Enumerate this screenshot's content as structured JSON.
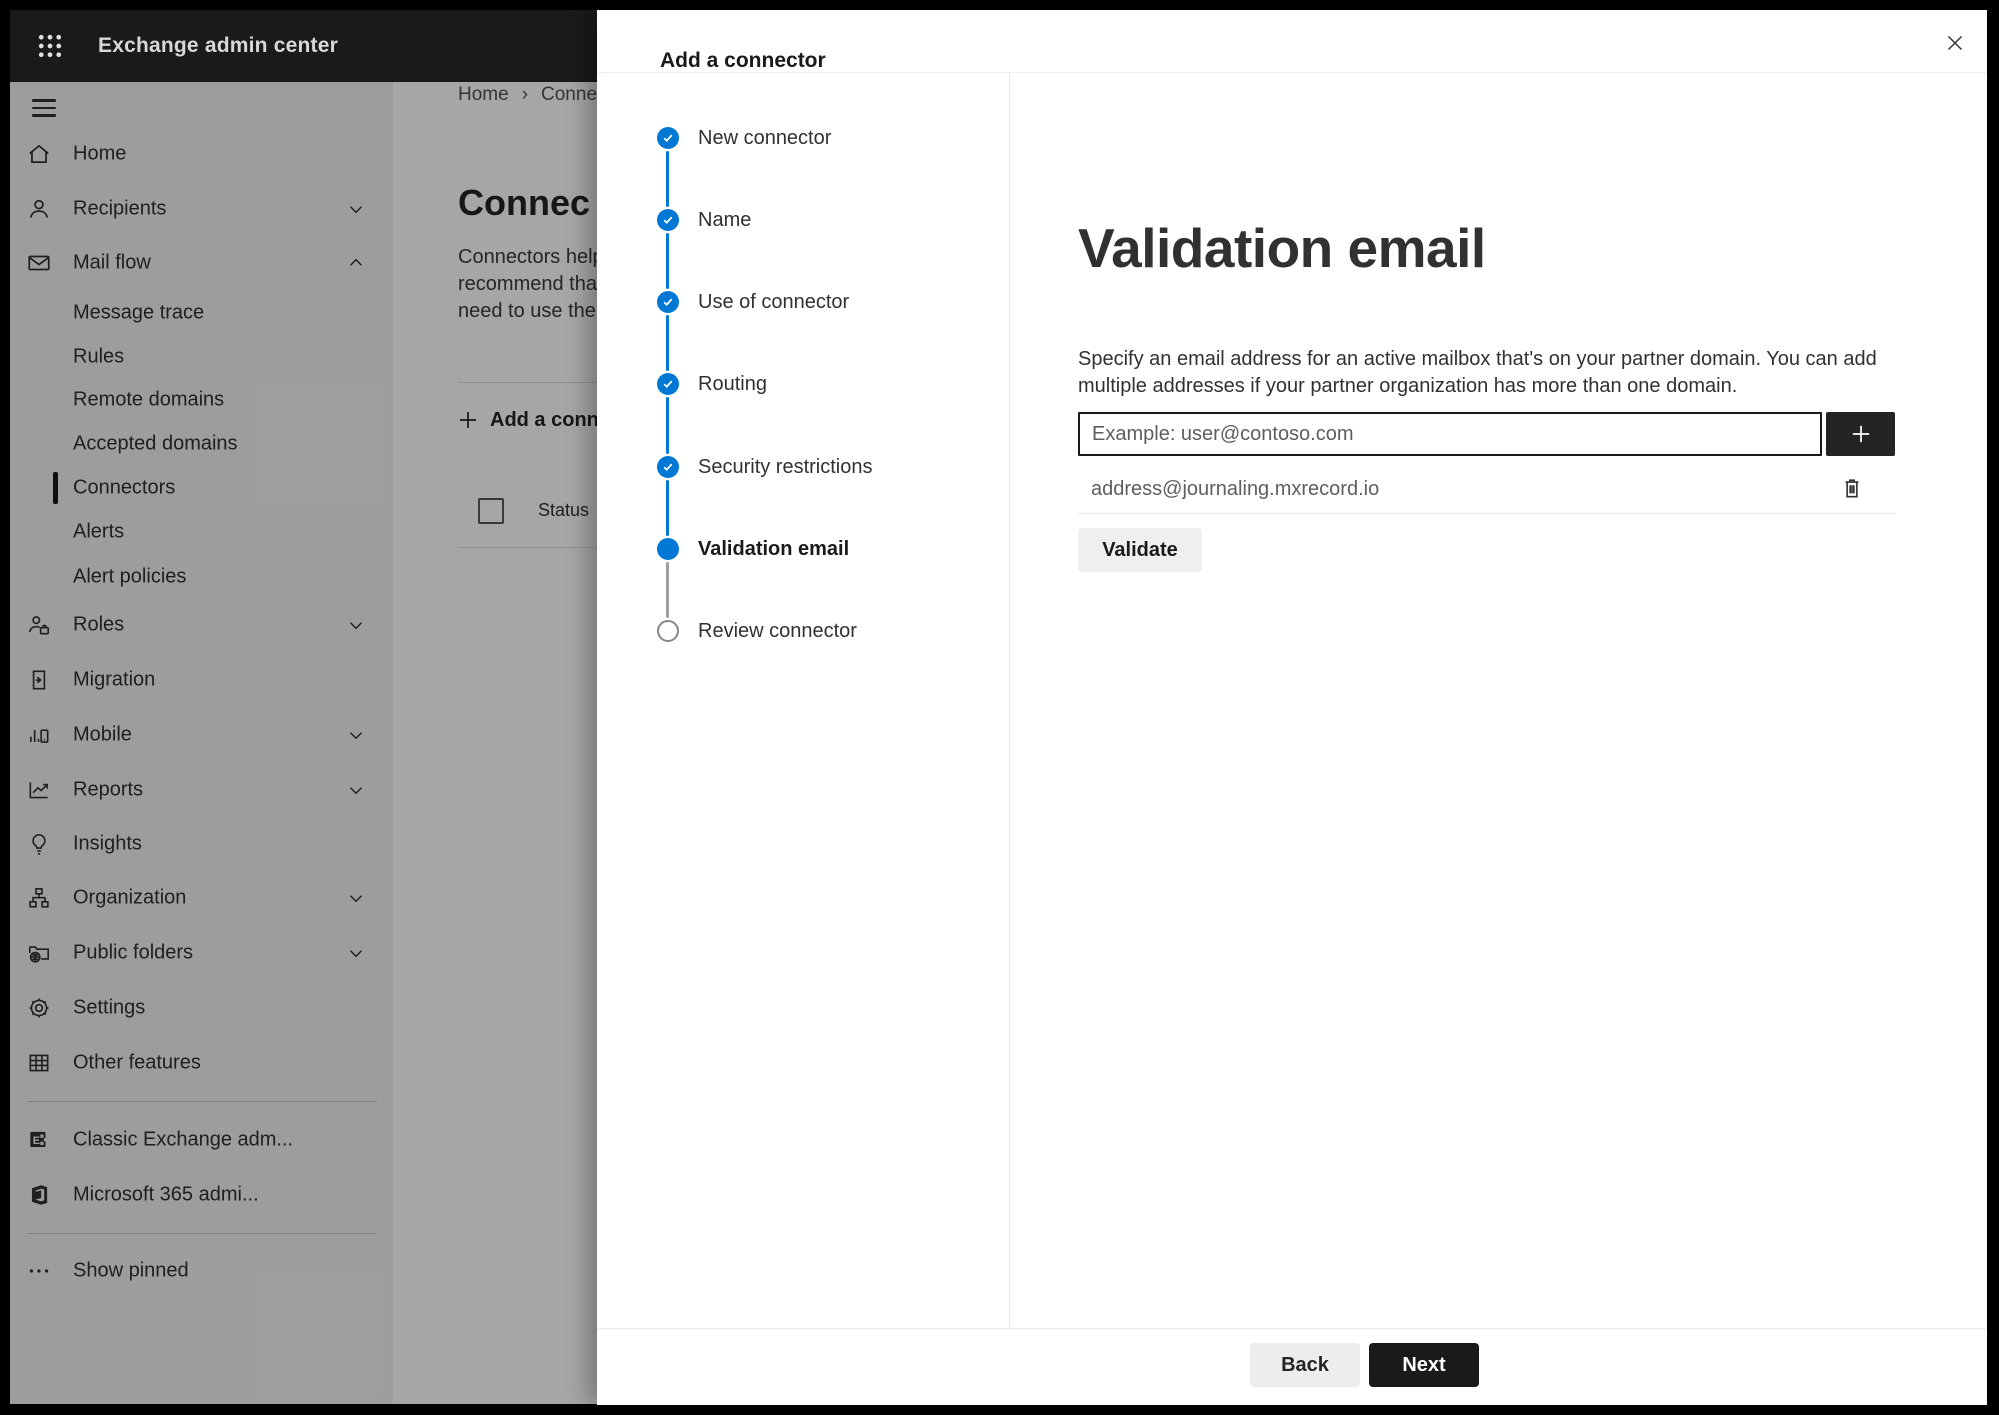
{
  "app_bar": {
    "title": "Exchange admin center",
    "app_launcher_icon": "app-launcher-waffle"
  },
  "sidebar": {
    "items": [
      {
        "label": "Home",
        "icon": "home-icon",
        "level": "top"
      },
      {
        "label": "Recipients",
        "icon": "person-icon",
        "level": "top",
        "chevron": "down"
      },
      {
        "label": "Mail flow",
        "icon": "mail-icon",
        "level": "top",
        "chevron": "up",
        "expanded": true
      },
      {
        "label": "Message trace",
        "level": "sub"
      },
      {
        "label": "Rules",
        "level": "sub"
      },
      {
        "label": "Remote domains",
        "level": "sub"
      },
      {
        "label": "Accepted domains",
        "level": "sub"
      },
      {
        "label": "Connectors",
        "level": "sub",
        "selected": true
      },
      {
        "label": "Alerts",
        "level": "sub"
      },
      {
        "label": "Alert policies",
        "level": "sub"
      },
      {
        "label": "Roles",
        "icon": "roles-person-icon",
        "level": "top",
        "chevron": "down"
      },
      {
        "label": "Migration",
        "icon": "migration-icon",
        "level": "top"
      },
      {
        "label": "Mobile",
        "icon": "mobile-icon",
        "level": "top",
        "chevron": "down"
      },
      {
        "label": "Reports",
        "icon": "reports-icon",
        "level": "top",
        "chevron": "down"
      },
      {
        "label": "Insights",
        "icon": "lightbulb-icon",
        "level": "top"
      },
      {
        "label": "Organization",
        "icon": "org-chart-icon",
        "level": "top",
        "chevron": "down"
      },
      {
        "label": "Public folders",
        "icon": "folder-globe-icon",
        "level": "top",
        "chevron": "down"
      },
      {
        "label": "Settings",
        "icon": "gear-icon",
        "level": "top"
      },
      {
        "label": "Other features",
        "icon": "grid-icon",
        "level": "top"
      },
      {
        "label": "Classic Exchange adm...",
        "icon": "exchange-logo-icon",
        "level": "top"
      },
      {
        "label": "Microsoft 365 admi...",
        "icon": "microsoft365-logo-icon",
        "level": "top"
      },
      {
        "label": "Show pinned",
        "icon": "ellipsis-icon",
        "level": "top"
      }
    ]
  },
  "background_page": {
    "breadcrumb": {
      "home": "Home",
      "separator": "›",
      "current": "Conne"
    },
    "title": "Connec",
    "description_lines": [
      "Connectors help",
      "recommend that",
      "need to use ther"
    ],
    "add_button_label": "Add a conn",
    "table": {
      "status_header": "Status"
    }
  },
  "modal": {
    "title": "Add a connector",
    "steps": [
      {
        "label": "New connector",
        "state": "completed"
      },
      {
        "label": "Name",
        "state": "completed"
      },
      {
        "label": "Use of connector",
        "state": "completed"
      },
      {
        "label": "Routing",
        "state": "completed"
      },
      {
        "label": "Security restrictions",
        "state": "completed"
      },
      {
        "label": "Validation email",
        "state": "current"
      },
      {
        "label": "Review connector",
        "state": "upcoming"
      }
    ],
    "content": {
      "heading": "Validation email",
      "description": "Specify an email address for an active mailbox that's on your partner domain. You can add multiple addresses if your partner organization has more than one domain.",
      "email_input": {
        "placeholder": "Example: user@contoso.com",
        "value": ""
      },
      "addresses": [
        {
          "email": "address@journaling.mxrecord.io"
        }
      ],
      "validate_button": "Validate"
    },
    "footer": {
      "back": "Back",
      "next": "Next"
    }
  },
  "colors": {
    "accent": "#0078d4",
    "app_bar_bg": "#1b1a19",
    "primary_button_bg": "#1b1a19",
    "step_upcoming_gray": "#8a8886",
    "scrim": "rgba(0,0,0,0.35)"
  }
}
